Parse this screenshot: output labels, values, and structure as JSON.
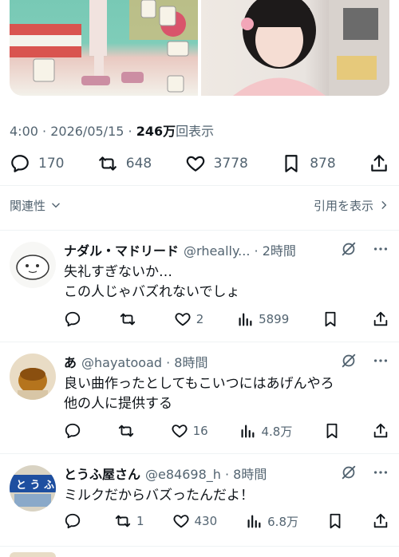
{
  "post": {
    "time": "4:00",
    "sep": " · ",
    "date": "2026/05/15",
    "views_number": "246万",
    "views_suffix": "回表示",
    "stats": {
      "replies": "170",
      "reposts": "648",
      "likes": "3778",
      "bookmarks": "878"
    }
  },
  "sort": {
    "label": "関連性",
    "quotes": "引用を表示"
  },
  "replies": [
    {
      "name": "ナダル・マドリード",
      "handle": "@rheally... · 2時間",
      "lines": [
        "失礼すぎないか…",
        "この人じゃバズれないでしょ"
      ],
      "stats": {
        "replies": "",
        "reposts": "",
        "likes": "2",
        "views": "5899"
      }
    },
    {
      "name": "あ",
      "handle": "@hayatooad · 8時間",
      "lines": [
        "良い曲作ったとしてもこいつにはあげんやろ",
        "他の人に提供する"
      ],
      "stats": {
        "replies": "",
        "reposts": "",
        "likes": "16",
        "views": "4.8万"
      }
    },
    {
      "name": "とうふ屋さん",
      "handle": "@e84698_h · 8時間",
      "lines": [
        "ミルクだからバズったんだよ！"
      ],
      "stats": {
        "replies": "",
        "reposts": "1",
        "likes": "430",
        "views": "6.8万"
      }
    }
  ],
  "icons": [
    "reply-icon",
    "repost-icon",
    "like-icon",
    "bookmark-icon",
    "share-icon",
    "views-icon",
    "grok-icon",
    "more-icon",
    "chevron-down-icon"
  ],
  "colors": {
    "text": "#0f1419",
    "secondary": "#536471",
    "divider": "#eff3f4"
  }
}
